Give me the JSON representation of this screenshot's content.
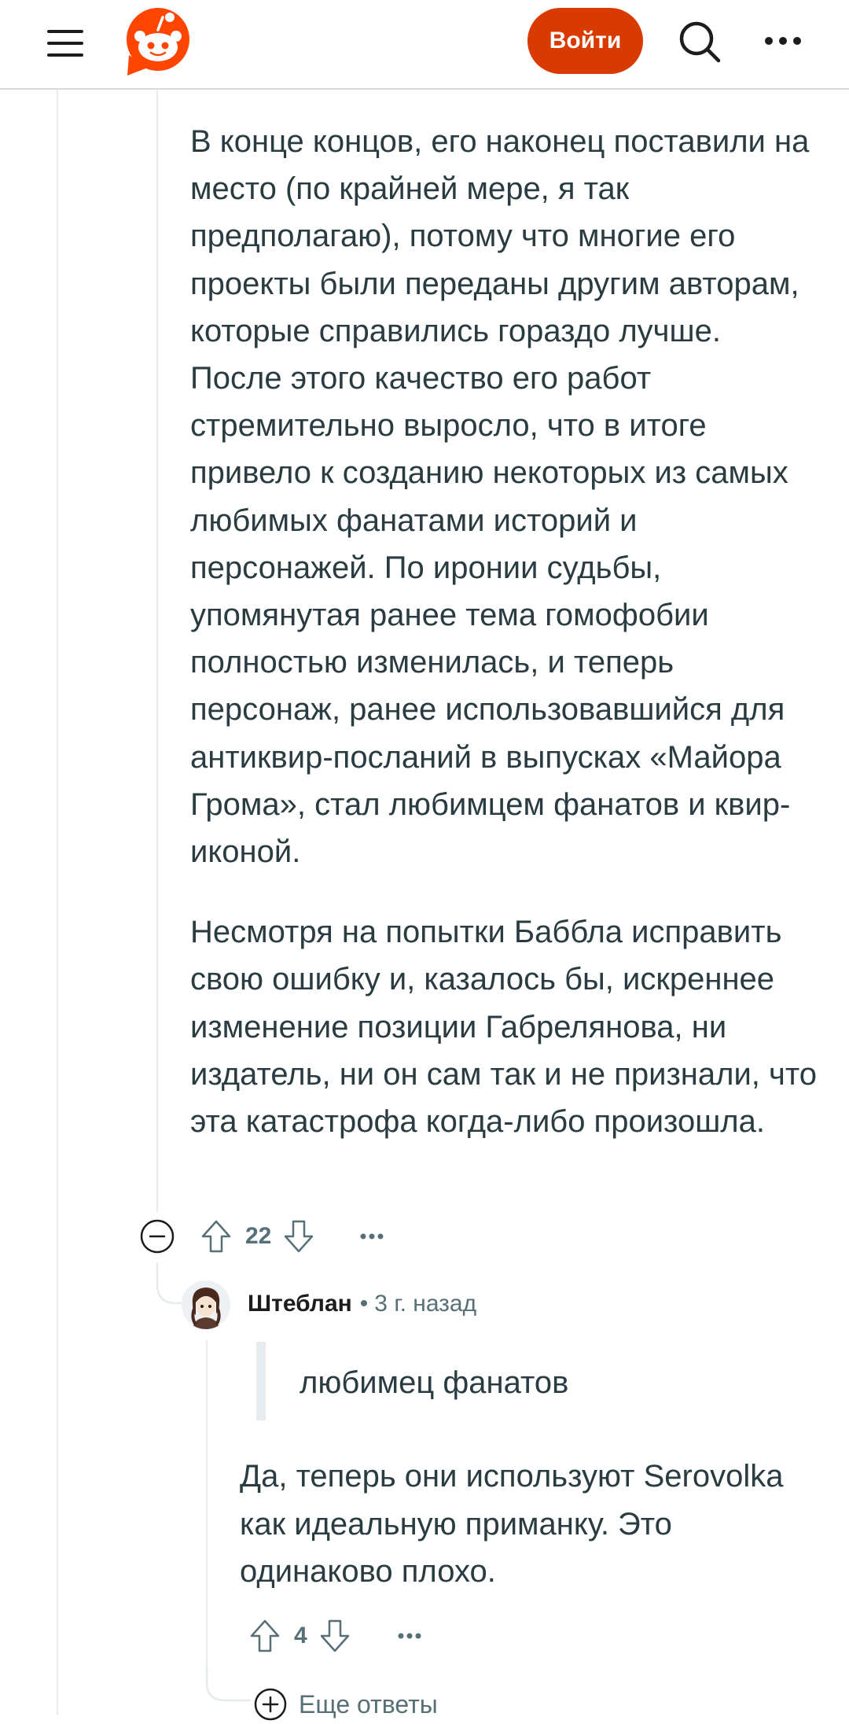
{
  "header": {
    "login_label": "Войти",
    "menu_icon": "hamburger-menu-icon",
    "logo_icon": "reddit-snoo-logo",
    "search_icon": "search-icon",
    "more_icon": "more-dots-icon",
    "brand_color": "#ff4500",
    "login_color": "#d93a00"
  },
  "comment": {
    "paragraphs": [
      "В конце концов, его наконец поставили на место (по крайней мере, я так предполагаю), потому что многие его проекты были переданы другим авторам, которые справились гораздо лучше. После этого качество его работ стремительно выросло, что в итоге привело к созданию некоторых из самых любимых фанатами историй и персонажей. По иронии судьбы, упомянутая ранее тема гомофобии полностью изменилась, и теперь персонаж, ранее использовавшийся для антиквир-посланий в выпусках «Майора Грома», стал любимцем фанатов и квир-иконой.",
      "Несмотря на попытки Баббла исправить свою ошибку и, казалось бы, искреннее изменение позиции Габрелянова, ни издатель, ни он сам так и не признали, что эта катастрофа когда-либо произошла."
    ],
    "votes": "22"
  },
  "reply": {
    "author": "Штеблан",
    "separator": "•",
    "time": "3 г. назад",
    "quote": "любимец фанатов",
    "body": "Да, теперь они используют Serovolka как идеальную приманку. Это одинаково плохо.",
    "votes": "4"
  },
  "more_replies_label": "Еще ответы"
}
